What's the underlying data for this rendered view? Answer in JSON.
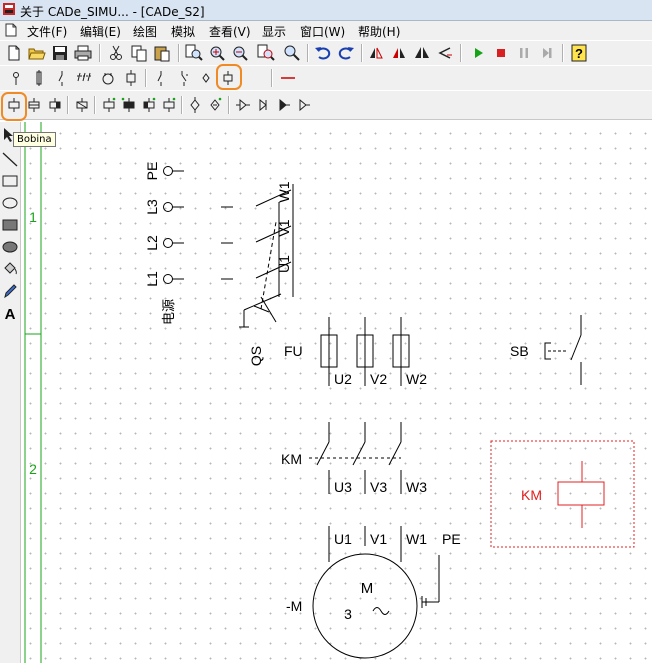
{
  "window": {
    "title": "关于 CADe_SIMU... - [CADe_S2]"
  },
  "menu": {
    "items": [
      "文件(F)",
      "编辑(E)",
      "绘图",
      "模拟",
      "查看(V)",
      "显示",
      "窗口(W)",
      "帮助(H)"
    ]
  },
  "toolbars": {
    "main_icons": [
      "new-file-icon",
      "open-folder-icon",
      "save-icon",
      "print-icon",
      "cut-icon",
      "copy-icon",
      "paste-icon",
      "zoom-fit-icon",
      "zoom-in-icon",
      "zoom-out-icon",
      "zoom-window-icon",
      "pan-icon",
      "undo-icon",
      "redo-icon",
      "flip-icon",
      "mirror-icon",
      "rotate-icon",
      "rotate-left-icon",
      "simulate-play-icon",
      "simulate-stop-icon",
      "simulate-pause-icon",
      "simulate-step-icon",
      "help-icon"
    ],
    "highlight_color": "#f08a24"
  },
  "tooltip": {
    "text": "Bobina"
  },
  "left_tools": [
    "pointer-icon",
    "line-icon",
    "rectangle-icon",
    "ellipse-icon",
    "filled-rectangle-icon",
    "filled-ellipse-icon",
    "fill-bucket-icon",
    "pen-icon",
    "text-tool-icon"
  ],
  "canvas": {
    "row_labels": [
      "1",
      "2"
    ],
    "row_label_color": "#1aa31a",
    "supply": {
      "terminals": [
        "PE",
        "L3",
        "L2",
        "L1"
      ],
      "caption": "电源",
      "breaker_tag": "QS",
      "breaker_terminals": [
        "U1",
        "V1",
        "W1"
      ]
    },
    "fuse": {
      "tag": "FU",
      "terminals": [
        "U2",
        "V2",
        "W2"
      ]
    },
    "pushbutton": {
      "tag": "SB"
    },
    "contactor": {
      "tag": "KM",
      "terminals": [
        "U3",
        "V3",
        "W3"
      ]
    },
    "coil": {
      "tag": "KM",
      "color": "#e02020"
    },
    "motor": {
      "tag": "-M",
      "symbol": "M",
      "phases": "3",
      "ac_symbol": "~",
      "terminals": [
        "U1",
        "V1",
        "W1",
        "PE"
      ]
    }
  }
}
